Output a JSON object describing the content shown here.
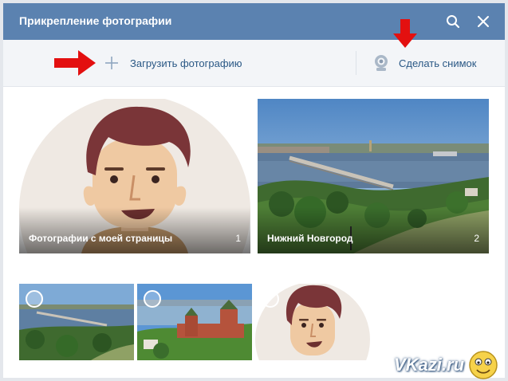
{
  "dialog": {
    "title": "Прикрепление фотографии",
    "search_icon": "search-icon",
    "close_icon": "close-icon"
  },
  "toolbar": {
    "upload_label": "Загрузить фотографию",
    "upload_icon": "plus-icon",
    "snapshot_label": "Сделать снимок",
    "snapshot_icon": "webcam-icon"
  },
  "albums": [
    {
      "name": "Фотографии с моей страницы",
      "count": "1"
    },
    {
      "name": "Нижний Новгород",
      "count": "2"
    }
  ],
  "photos": [
    {
      "subject": "river-bridge-photo"
    },
    {
      "subject": "kremlin-photo"
    },
    {
      "subject": "avatar-photo"
    }
  ],
  "watermark": {
    "text": "VKazi.ru"
  },
  "colors": {
    "header": "#5b82b0",
    "link": "#2a5885",
    "arrow": "#e31010"
  }
}
